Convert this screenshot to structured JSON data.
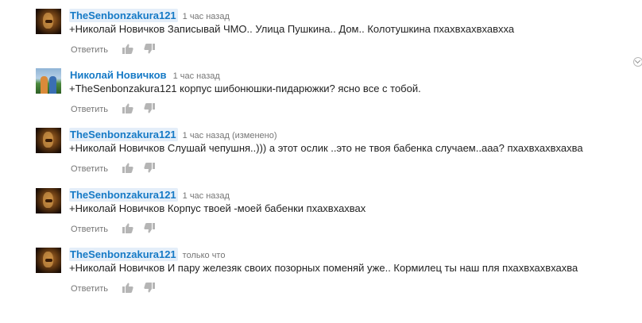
{
  "comments": [
    {
      "author": "TheSenbonzakura121",
      "time": "1 час назад",
      "text": "+Николай Новичков Записывай ЧМО.. Улица Пушкина.. Дом.. Колотушкина пхахвхахвхавхха",
      "reply_label": "Ответить",
      "avatar": "dark-portrait-avatar"
    },
    {
      "author": "Николай Новичков",
      "time": "1 час назад",
      "text": "+TheSenbonzakura121 корпус шибонюшки-пидарюжки? ясно все с тобой.",
      "reply_label": "Ответить",
      "avatar": "outdoor-photo-avatar"
    },
    {
      "author": "TheSenbonzakura121",
      "time": "1 час назад (изменено)",
      "text": "+Николай Новичков Слушай чепушня..))) а этот ослик ..это не твоя бабенка случаем..ааа? пхахвхахвхахва",
      "reply_label": "Ответить",
      "avatar": "dark-portrait-avatar"
    },
    {
      "author": "TheSenbonzakura121",
      "time": "1 час назад",
      "text": "+Николай Новичков Корпус твоей  -моей бабенки пхахвхахвах",
      "reply_label": "Ответить",
      "avatar": "dark-portrait-avatar"
    },
    {
      "author": "TheSenbonzakura121",
      "time": "только что",
      "text": "+Николай Новичков И пару железяк своих позорных  поменяй уже.. Кормилец ты наш пля пхахвхахвхахва",
      "reply_label": "Ответить",
      "avatar": "dark-portrait-avatar"
    }
  ],
  "colors": {
    "author_link": "#167ac6",
    "author_highlight": "#e4eef9",
    "meta_text": "#767676",
    "body_text": "#222222",
    "icon": "#b5b5b5"
  },
  "icons": {
    "like": "thumbs-up-icon",
    "dislike": "thumbs-down-icon",
    "menu": "chevron-down-icon"
  }
}
